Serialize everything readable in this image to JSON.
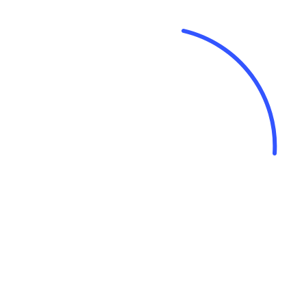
{
  "spinner": {
    "icon": "loading-spinner-arc",
    "color": "#3355ff",
    "arc_fraction": 0.24
  }
}
